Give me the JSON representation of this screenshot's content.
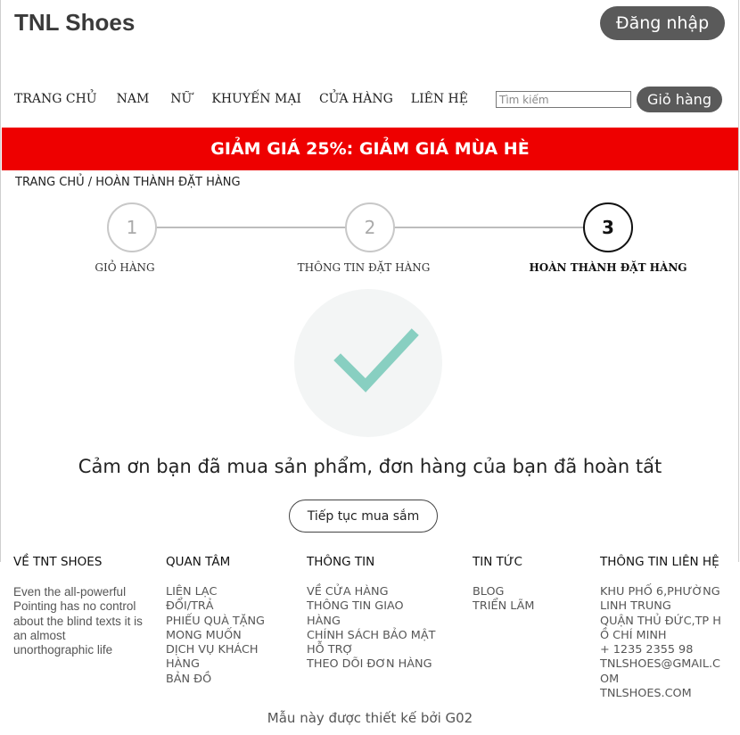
{
  "header": {
    "logo": "TNL Shoes",
    "login_label": "Đăng nhập"
  },
  "nav": {
    "items": [
      "TRANG CHỦ",
      "NAM",
      "NỮ",
      "KHUYẾN MẠI",
      "CỬA HÀNG",
      "LIÊN HỆ"
    ],
    "search_placeholder": "Tìm kiếm",
    "cart_label": "Giỏ hàng"
  },
  "promo": {
    "text": "GIẢM GIÁ 25%: GIẢM GIÁ MÙA HÈ",
    "color": "#ee0000"
  },
  "breadcrumb": {
    "text": "TRANG CHỦ / HOÀN THÀNH ĐẶT HÀNG"
  },
  "steps": [
    {
      "number": "1",
      "label": "GIỎ HÀNG",
      "active": false
    },
    {
      "number": "2",
      "label": "THÔNG TIN ĐẶT HÀNG",
      "active": false
    },
    {
      "number": "3",
      "label": "HOÀN THÀNH ĐẶT HÀNG",
      "active": true
    }
  ],
  "success": {
    "icon": "check-icon",
    "check_color": "#88cfc1",
    "message": "Cảm ơn bạn đã mua sản phẩm, đơn hàng của bạn đã hoàn tất",
    "continue_label": "Tiếp tục mua sắm"
  },
  "footer": {
    "about": {
      "title": "VỀ TNT SHOES",
      "text": "Even the all-powerful Pointing has no control about the blind texts it is an almost unorthographic life"
    },
    "interest": {
      "title": "QUAN TÂM",
      "links": [
        "LIÊN LẠC",
        "ĐỔI/TRẢ",
        "PHIẾU QUÀ TẶNG",
        "MONG MUỐN",
        "DỊCH VỤ KHÁCH HÀNG",
        "BẢN ĐỒ"
      ]
    },
    "info": {
      "title": "THÔNG TIN",
      "links": [
        "VỀ CỬA HÀNG",
        "THÔNG TIN GIAO HÀNG",
        "CHÍNH SÁCH BẢO MẬT",
        "HỖ TRỢ",
        "THEO DÕI ĐƠN HÀNG"
      ]
    },
    "news": {
      "title": "TIN TỨC",
      "links": [
        "BLOG",
        "TRIỂN LÃM"
      ]
    },
    "contact": {
      "title": "THÔNG TIN LIÊN HỆ",
      "lines": [
        "KHU PHỐ 6,PHƯỜNG LINH TRUNG",
        "QUẬN THỦ ĐỨC,TP HỒ CHÍ MINH",
        "+ 1235 2355 98",
        "TNLSHOES@GMAIL.COM",
        "TNLSHOES.COM"
      ]
    },
    "credit": "Mẫu này được thiết kế bởi G02"
  }
}
